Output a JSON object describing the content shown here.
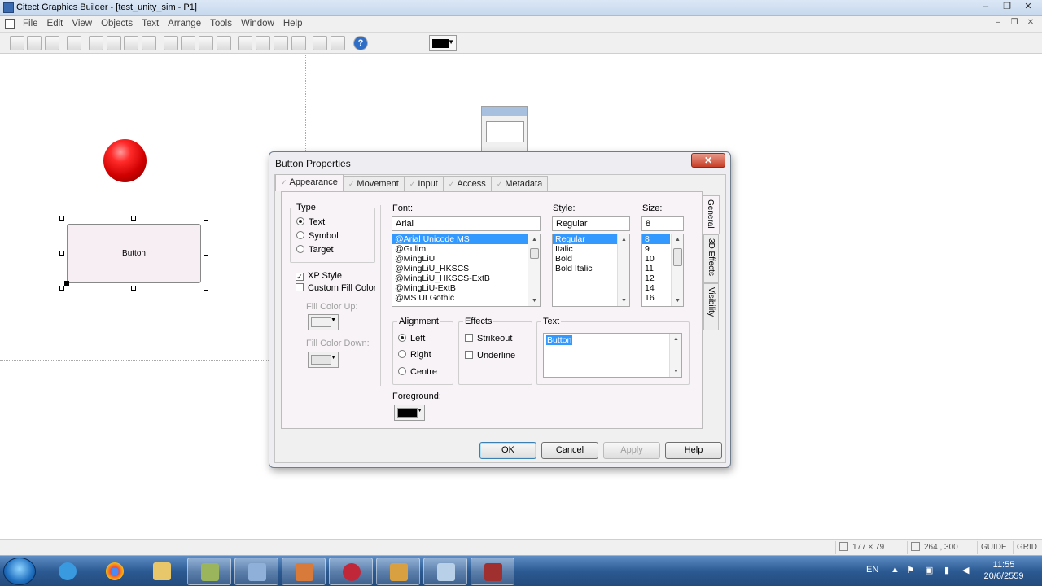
{
  "window": {
    "title": "Citect Graphics Builder - [test_unity_sim - P1]",
    "minimize": "–",
    "restore": "❐",
    "close": "✕"
  },
  "menubar": {
    "items": [
      "File",
      "Edit",
      "View",
      "Objects",
      "Text",
      "Arrange",
      "Tools",
      "Window",
      "Help"
    ],
    "mdi_min": "–",
    "mdi_restore": "❐",
    "mdi_close": "✕"
  },
  "toolbar": {
    "icons": [
      "new-icon",
      "open-icon",
      "save-icon",
      "print-preview-icon",
      "page-icon",
      "cut-icon",
      "copy-icon",
      "paste-icon",
      "undo-icon",
      "redo-icon",
      "group-icon",
      "ungroup-icon",
      "align-icon",
      "distribute-icon",
      "snap-icon",
      "grid-icon",
      "help-icon"
    ],
    "help_label": "?",
    "fill_color": "#000000"
  },
  "canvas": {
    "button_label": "Button",
    "ball_color": "#e00000"
  },
  "dialog": {
    "title": "Button Properties",
    "close_label": "✕",
    "tabs": [
      "Appearance",
      "Movement",
      "Input",
      "Access",
      "Metadata"
    ],
    "active_tab": "Appearance",
    "side_tabs": [
      "General",
      "3D Effects",
      "Visibility"
    ],
    "type": {
      "legend": "Type",
      "options": [
        "Text",
        "Symbol",
        "Target"
      ],
      "selected": "Text"
    },
    "xp_style": {
      "label": "XP Style",
      "checked": true
    },
    "custom_fill": {
      "label": "Custom Fill Color",
      "checked": false
    },
    "fill_up_label": "Fill Color Up:",
    "fill_down_label": "Fill Color Down:",
    "font": {
      "label": "Font:",
      "value": "Arial",
      "list": [
        "@Arial Unicode MS",
        "@Gulim",
        "@MingLiU",
        "@MingLiU_HKSCS",
        "@MingLiU_HKSCS-ExtB",
        "@MingLiU-ExtB",
        "@MS UI Gothic"
      ],
      "selected": "@Arial Unicode MS"
    },
    "style": {
      "label": "Style:",
      "value": "Regular",
      "list": [
        "Regular",
        "Italic",
        "Bold",
        "Bold Italic"
      ],
      "selected": "Regular"
    },
    "size": {
      "label": "Size:",
      "value": "8",
      "list": [
        "8",
        "9",
        "10",
        "11",
        "12",
        "14",
        "16"
      ],
      "selected": "8"
    },
    "alignment": {
      "legend": "Alignment",
      "options": [
        "Left",
        "Right",
        "Centre"
      ],
      "selected": "Left"
    },
    "effects": {
      "legend": "Effects",
      "strikeout": "Strikeout",
      "underline": "Underline"
    },
    "text": {
      "legend": "Text",
      "value": "Button"
    },
    "foreground": {
      "label": "Foreground:",
      "color": "#000000"
    },
    "buttons": {
      "ok": "OK",
      "cancel": "Cancel",
      "apply": "Apply",
      "help": "Help"
    }
  },
  "statusbar": {
    "size": "177 × 79",
    "position": "264 , 300",
    "guide": "GUIDE",
    "grid": "GRID"
  },
  "taskbar": {
    "lang": "EN",
    "time": "11:55",
    "date": "20/6/2559"
  }
}
